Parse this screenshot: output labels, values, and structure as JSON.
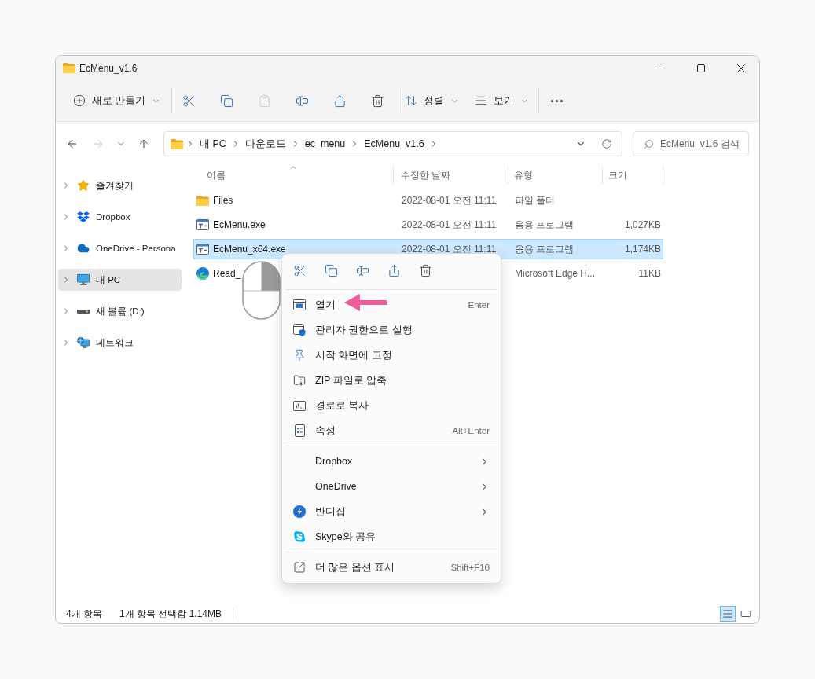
{
  "window": {
    "title": "EcMenu_v1.6"
  },
  "toolbar": {
    "new_button": {
      "label": "새로 만들기"
    },
    "actions": [
      {
        "disabled": false
      },
      {
        "disabled": false
      },
      {
        "disabled": true
      },
      {
        "disabled": false
      },
      {
        "disabled": false
      },
      {
        "disabled": false
      }
    ],
    "sort_button": {
      "label": "정렬"
    },
    "view_button": {
      "label": "보기"
    }
  },
  "navigation": {
    "buttons": [
      {
        "disabled": false
      },
      {
        "disabled": true
      },
      {
        "disabled": false
      },
      {
        "disabled": false
      }
    ],
    "breadcrumbs": [
      "내 PC",
      "다운로드",
      "ec_menu",
      "EcMenu_v1.6"
    ],
    "search": {
      "placeholder": "EcMenu_v1.6 검색"
    }
  },
  "sidebar": {
    "items": [
      {
        "kind": "favorites",
        "label": "즐겨찾기",
        "selected": false
      },
      {
        "kind": "dropbox",
        "label": "Dropbox",
        "selected": false
      },
      {
        "kind": "onedrive",
        "label": "OneDrive - Persona",
        "selected": false
      },
      {
        "kind": "pc",
        "label": "내 PC",
        "selected": true
      },
      {
        "kind": "drive",
        "label": "새 볼륨 (D:)",
        "selected": false
      },
      {
        "kind": "network",
        "label": "네트워크",
        "selected": false
      }
    ]
  },
  "file_list": {
    "columns": [
      {
        "label": "이름",
        "sorted": true
      },
      {
        "label": "수정한 날짜",
        "sorted": false
      },
      {
        "label": "유형",
        "sorted": false
      },
      {
        "label": "크기",
        "sorted": false
      }
    ],
    "rows": [
      {
        "kind": "folder",
        "name": "Files",
        "modified": "2022-08-01 오전 11:11",
        "type": "파일 폴더",
        "selected": false
      },
      {
        "kind": "program",
        "name": "EcMenu.exe",
        "modified": "2022-08-01 오전 11:11",
        "type": "응용 프로그램",
        "size": "1,027KB",
        "selected": false
      },
      {
        "kind": "program",
        "name": "EcMenu_x64.exe",
        "modified": "2022-08-01 오전 11:11",
        "type": "응용 프로그램",
        "size": "1,174KB",
        "selected": true
      },
      {
        "kind": "web_page",
        "name": "Read_",
        "type": "Microsoft Edge H...",
        "size": "11KB",
        "selected": false
      }
    ]
  },
  "context_menu": {
    "items": [
      {
        "kind": "command",
        "label": "열기",
        "shortcut": "Enter"
      },
      {
        "kind": "command",
        "label": "관리자 권한으로 실행"
      },
      {
        "kind": "command",
        "label": "시작 화면에 고정"
      },
      {
        "kind": "command",
        "label": "ZIP 파일로 압축"
      },
      {
        "kind": "command",
        "label": "경로로 복사"
      },
      {
        "kind": "command",
        "label": "속성",
        "shortcut": "Alt+Enter"
      },
      {
        "kind": "separator"
      },
      {
        "kind": "submenu",
        "label": "Dropbox"
      },
      {
        "kind": "submenu",
        "label": "OneDrive"
      },
      {
        "kind": "submenu",
        "label": "반디집"
      },
      {
        "kind": "command",
        "label": "Skype와 공유"
      },
      {
        "kind": "separator"
      },
      {
        "kind": "command",
        "label": "더 많은 옵션 표시",
        "shortcut": "Shift+F10"
      }
    ]
  },
  "status_bar": {
    "item_count": "4개 항목",
    "selection": "1개 항목 선택함 1.14MB",
    "views": [
      {
        "selected": true
      },
      {
        "selected": false
      }
    ]
  }
}
